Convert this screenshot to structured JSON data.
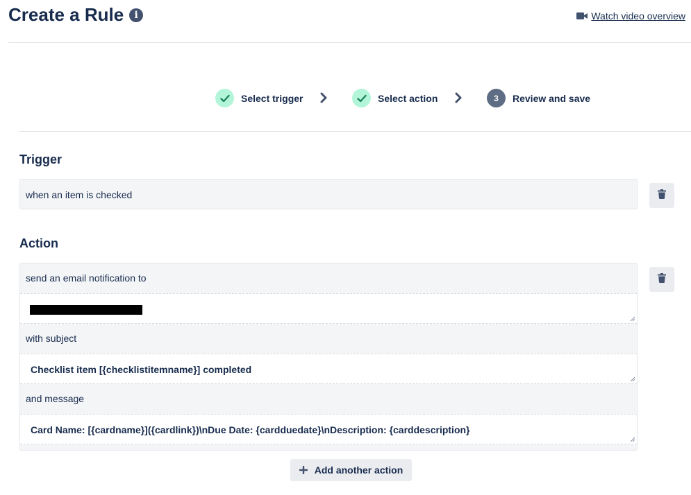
{
  "header": {
    "title": "Create a Rule",
    "info_icon": "info-icon",
    "video_link_label": "Watch video overview",
    "video_icon": "video-camera-icon"
  },
  "steps": [
    {
      "label": "Select trigger",
      "state": "done"
    },
    {
      "label": "Select action",
      "state": "done"
    },
    {
      "number": "3",
      "label": "Review and save",
      "state": "current"
    }
  ],
  "trigger": {
    "heading": "Trigger",
    "text": "when an item is checked"
  },
  "action": {
    "heading": "Action",
    "line1": "send an email notification to",
    "recipient": "",
    "subject_label": "with subject",
    "subject_value": "Checklist item [{checklistitemname}] completed",
    "message_label": "and message",
    "message_value": "Card Name: [{cardname}]({cardlink})\\nDue Date: {cardduedate}\\nDescription: {carddescription}"
  },
  "add_action_label": "Add another action",
  "colors": {
    "text": "#172b4d",
    "step_done_bg": "#b3f5d9",
    "step_check": "#1f845a",
    "step_current_bg": "#5e6c84",
    "panel_bg": "#f4f5f7",
    "button_bg": "#ebecf0"
  }
}
